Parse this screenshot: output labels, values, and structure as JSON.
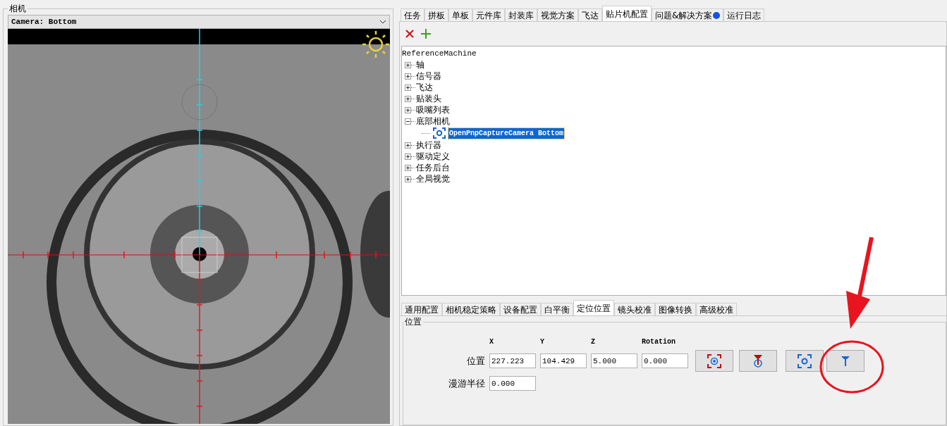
{
  "camera_panel": {
    "title": "相机",
    "camera_select": {
      "value": "Camera: Bottom"
    }
  },
  "main_tabs": [
    {
      "label": "任务",
      "selected": false
    },
    {
      "label": "拼板",
      "selected": false
    },
    {
      "label": "单板",
      "selected": false
    },
    {
      "label": "元件库",
      "selected": false
    },
    {
      "label": "封装库",
      "selected": false
    },
    {
      "label": "视觉方案",
      "selected": false
    },
    {
      "label": "飞达",
      "selected": false
    },
    {
      "label": "贴片机配置",
      "selected": true
    },
    {
      "label": "问题&解决方案",
      "selected": false,
      "indicator": true
    },
    {
      "label": "运行日志",
      "selected": false
    }
  ],
  "tree": {
    "root": "ReferenceMachine",
    "children": [
      {
        "label": "轴",
        "expanded": false,
        "selected": false
      },
      {
        "label": "信号器",
        "expanded": false,
        "selected": false
      },
      {
        "label": "飞达",
        "expanded": false,
        "selected": false
      },
      {
        "label": "贴装头",
        "expanded": false,
        "selected": false
      },
      {
        "label": "吸嘴列表",
        "expanded": false,
        "selected": false
      },
      {
        "label": "底部相机",
        "expanded": true,
        "selected": false,
        "children": [
          {
            "label": "OpenPnpCaptureCamera Bottom",
            "selected": true
          }
        ]
      },
      {
        "label": "执行器",
        "expanded": false,
        "selected": false
      },
      {
        "label": "驱动定义",
        "expanded": false,
        "selected": false
      },
      {
        "label": "任务后台",
        "expanded": false,
        "selected": false
      },
      {
        "label": "全局视觉",
        "expanded": false,
        "selected": false
      }
    ]
  },
  "config_tabs": [
    {
      "label": "通用配置",
      "selected": false
    },
    {
      "label": "相机稳定策略",
      "selected": false
    },
    {
      "label": "设备配置",
      "selected": false
    },
    {
      "label": "白平衡",
      "selected": false
    },
    {
      "label": "定位位置",
      "selected": true
    },
    {
      "label": "镜头校准",
      "selected": false
    },
    {
      "label": "图像转换",
      "selected": false
    },
    {
      "label": "高级校准",
      "selected": false
    }
  ],
  "position_group": {
    "title": "位置",
    "columns": [
      "X",
      "Y",
      "Z",
      "Rotation"
    ],
    "position_label": "位置",
    "position_values": [
      "227.223",
      "104.429",
      "5.000",
      "0.000"
    ],
    "roam_label": "漫游半径",
    "roam_value": "0.000"
  }
}
